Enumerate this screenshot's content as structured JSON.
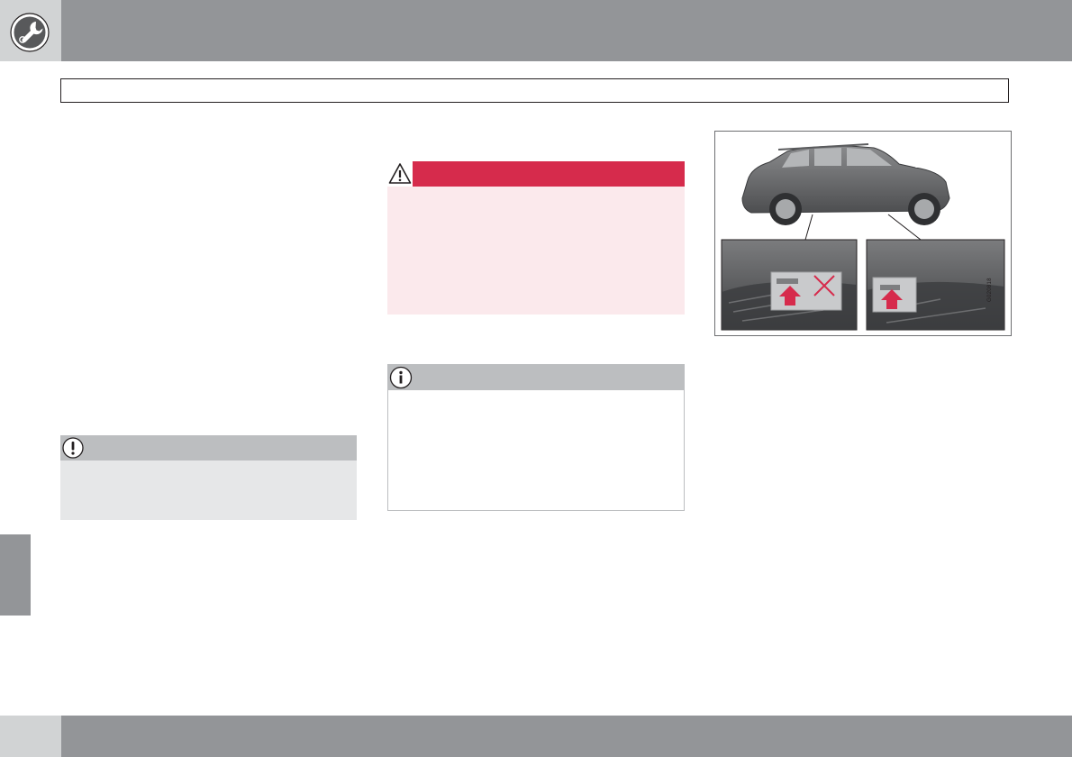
{
  "header": {
    "section_icon": "wrench-gear-icon",
    "title": ""
  },
  "sidebar_tab": {
    "label": ""
  },
  "caution_box": {
    "icon": "exclamation-icon",
    "text": ""
  },
  "warning_box": {
    "icon": "warning-triangle-icon",
    "accent_color": "#d62b4c",
    "background_color": "#fbe9ec",
    "text": ""
  },
  "note_box": {
    "icon": "info-icon",
    "text": ""
  },
  "illustration": {
    "subject": "car-jacking-points",
    "code": "G020818"
  },
  "footer": {
    "page_number": ""
  },
  "colors": {
    "band_gray": "#939598",
    "light_gray": "#d1d3d4",
    "box_gray": "#e6e7e8",
    "alert_red": "#d62b4c"
  }
}
